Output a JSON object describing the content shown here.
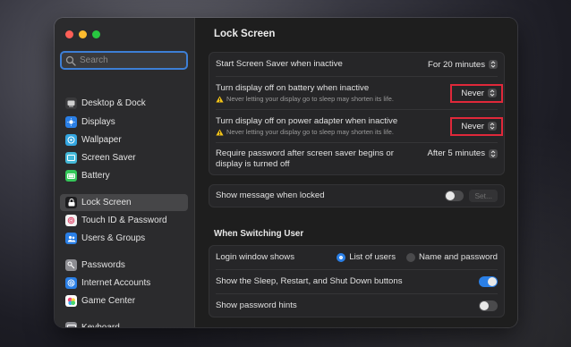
{
  "search": {
    "placeholder": "Search",
    "value": ""
  },
  "sidebar": {
    "items": [
      {
        "label": "Desktop & Dock",
        "icon": "desktop-dock-icon",
        "color": "#3a3a3c",
        "selected": false
      },
      {
        "label": "Displays",
        "icon": "displays-icon",
        "color": "#2a7fe6",
        "selected": false
      },
      {
        "label": "Wallpaper",
        "icon": "wallpaper-icon",
        "color": "#33a6e0",
        "selected": false
      },
      {
        "label": "Screen Saver",
        "icon": "screen-saver-icon",
        "color": "#43b8d8",
        "selected": false
      },
      {
        "label": "Battery",
        "icon": "battery-icon",
        "color": "#34c759",
        "selected": false
      },
      {
        "label": "Lock Screen",
        "icon": "lock-icon",
        "color": "#1c1c1e",
        "selected": true
      },
      {
        "label": "Touch ID & Password",
        "icon": "fingerprint-icon",
        "color": "#f2f2f2",
        "selected": false
      },
      {
        "label": "Users & Groups",
        "icon": "users-groups-icon",
        "color": "#2a7fe6",
        "selected": false
      },
      {
        "label": "Passwords",
        "icon": "key-icon",
        "color": "#8e8e93",
        "selected": false
      },
      {
        "label": "Internet Accounts",
        "icon": "at-sign-icon",
        "color": "#2a7fe6",
        "selected": false
      },
      {
        "label": "Game Center",
        "icon": "game-center-icon",
        "color": "#ffffff",
        "selected": false
      },
      {
        "label": "Keyboard",
        "icon": "keyboard-icon",
        "color": "#8e8e93",
        "selected": false
      }
    ]
  },
  "main": {
    "title": "Lock Screen",
    "screen_saver": {
      "label": "Start Screen Saver when inactive",
      "value": "For 20 minutes"
    },
    "display_battery": {
      "label": "Turn display off on battery when inactive",
      "value": "Never",
      "note": "Never letting your display go to sleep may shorten its life."
    },
    "display_adapter": {
      "label": "Turn display off on power adapter when inactive",
      "value": "Never",
      "note": "Never letting your display go to sleep may shorten its life."
    },
    "require_password": {
      "label_line1": "Require password after screen saver begins or",
      "label_line2": "display is turned off",
      "value": "After 5 minutes"
    },
    "show_message": {
      "label": "Show message when locked",
      "set_label": "Set...",
      "on": false
    },
    "switching_title": "When Switching User",
    "login_window": {
      "label": "Login window shows",
      "option1": "List of users",
      "option2": "Name and password",
      "selected": "List of users"
    },
    "sleep_buttons": {
      "label": "Show the Sleep, Restart, and Shut Down buttons",
      "on": true
    },
    "password_hints": {
      "label": "Show password hints",
      "on": false
    }
  },
  "colors": {
    "accent": "#2a7fe6",
    "highlight": "#e0283a",
    "warning": "#f5c518"
  }
}
